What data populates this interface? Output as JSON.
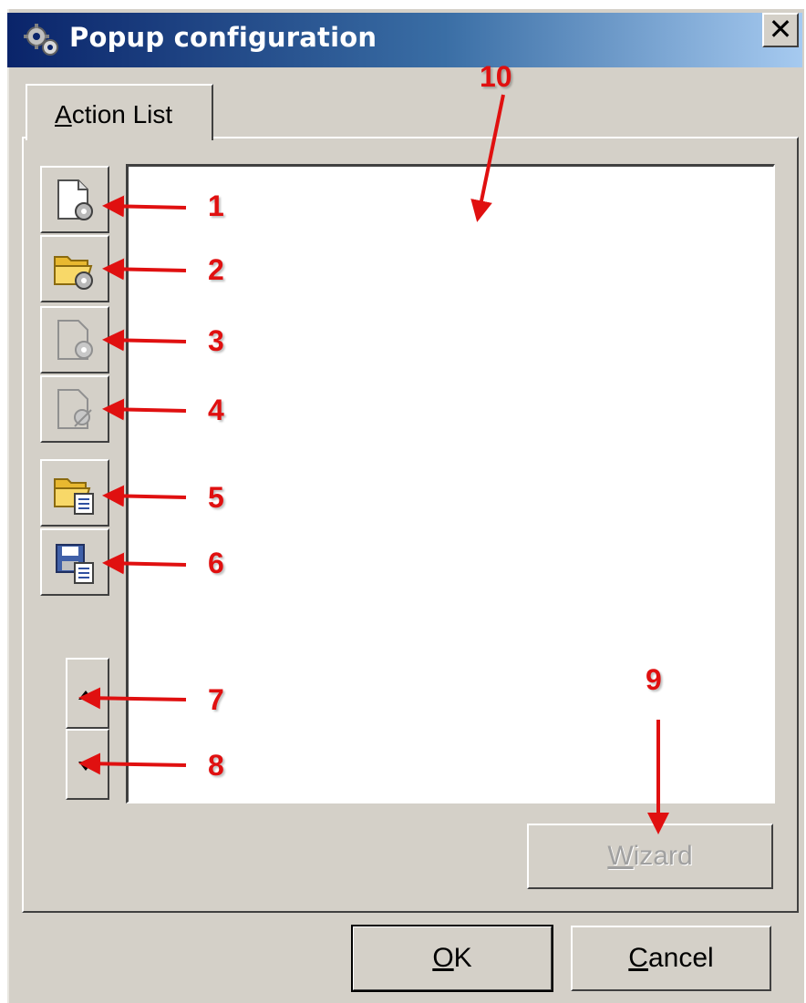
{
  "window": {
    "title": "Popup configuration",
    "close_label": "✕"
  },
  "tabs": [
    {
      "label_prefix": "",
      "mnemonic": "A",
      "label_rest": "ction List",
      "selected": true
    }
  ],
  "toolbar": {
    "buttons": [
      {
        "icon": "new-document-gear-icon",
        "enabled": true
      },
      {
        "icon": "open-folder-gear-icon",
        "enabled": true
      },
      {
        "icon": "edit-document-gear-icon",
        "enabled": false
      },
      {
        "icon": "delete-document-gear-icon",
        "enabled": false
      },
      {
        "icon": "open-folder-list-icon",
        "enabled": true
      },
      {
        "icon": "save-disk-list-icon",
        "enabled": true
      }
    ],
    "order_buttons": [
      {
        "icon": "move-up-arrow-icon"
      },
      {
        "icon": "move-down-arrow-icon"
      }
    ]
  },
  "action_list": {
    "items": []
  },
  "wizard_button": {
    "mnemonic": "W",
    "label_rest": "izard",
    "enabled": false
  },
  "footer": {
    "ok": {
      "mnemonic": "O",
      "label_rest": "K"
    },
    "cancel": {
      "mnemonic": "C",
      "label_rest": "ancel"
    }
  },
  "annotations": [
    "1",
    "2",
    "3",
    "4",
    "5",
    "6",
    "7",
    "8",
    "9",
    "10"
  ],
  "colors": {
    "title_gradient_start": "#0a246a",
    "title_gradient_end": "#a6caf0",
    "dialog_face": "#d4d0c8",
    "annotation_red": "#e01010"
  }
}
